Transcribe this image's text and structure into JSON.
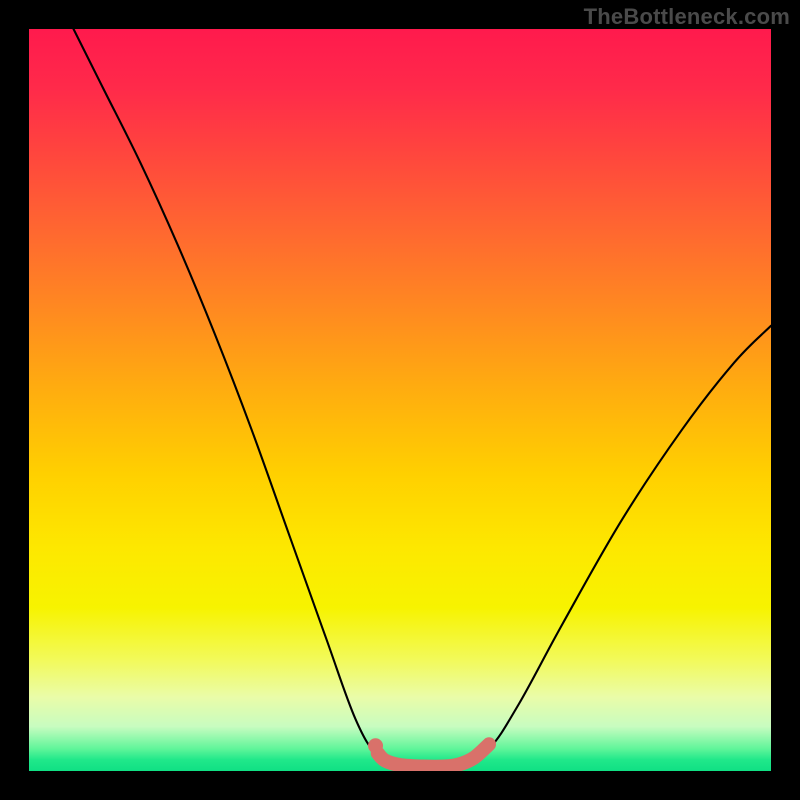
{
  "watermark": "TheBottleneck.com",
  "chart_data": {
    "type": "line",
    "title": "",
    "xlabel": "",
    "ylabel": "",
    "xlim": [
      0,
      100
    ],
    "ylim": [
      0,
      100
    ],
    "series": [
      {
        "name": "bottleneck-curve",
        "data": [
          {
            "x": 6,
            "y": 100
          },
          {
            "x": 10,
            "y": 92
          },
          {
            "x": 15,
            "y": 82
          },
          {
            "x": 20,
            "y": 71
          },
          {
            "x": 25,
            "y": 59
          },
          {
            "x": 30,
            "y": 46
          },
          {
            "x": 35,
            "y": 32
          },
          {
            "x": 40,
            "y": 18
          },
          {
            "x": 44,
            "y": 7
          },
          {
            "x": 47,
            "y": 2
          },
          {
            "x": 50,
            "y": 0.5
          },
          {
            "x": 55,
            "y": 0.3
          },
          {
            "x": 58,
            "y": 0.5
          },
          {
            "x": 62,
            "y": 3
          },
          {
            "x": 66,
            "y": 9
          },
          {
            "x": 72,
            "y": 20
          },
          {
            "x": 80,
            "y": 34
          },
          {
            "x": 88,
            "y": 46
          },
          {
            "x": 95,
            "y": 55
          },
          {
            "x": 100,
            "y": 60
          }
        ],
        "color": "#000000"
      },
      {
        "name": "optimal-band",
        "data": [
          {
            "x": 47,
            "y": 2.4
          },
          {
            "x": 48,
            "y": 1.4
          },
          {
            "x": 50,
            "y": 0.8
          },
          {
            "x": 53,
            "y": 0.6
          },
          {
            "x": 56,
            "y": 0.6
          },
          {
            "x": 58,
            "y": 0.9
          },
          {
            "x": 60,
            "y": 1.8
          },
          {
            "x": 62,
            "y": 3.6
          }
        ],
        "color": "#d9716a"
      },
      {
        "name": "optimal-dot",
        "data": [
          {
            "x": 46.7,
            "y": 3.4
          }
        ],
        "color": "#d9716a"
      }
    ],
    "annotations": []
  }
}
